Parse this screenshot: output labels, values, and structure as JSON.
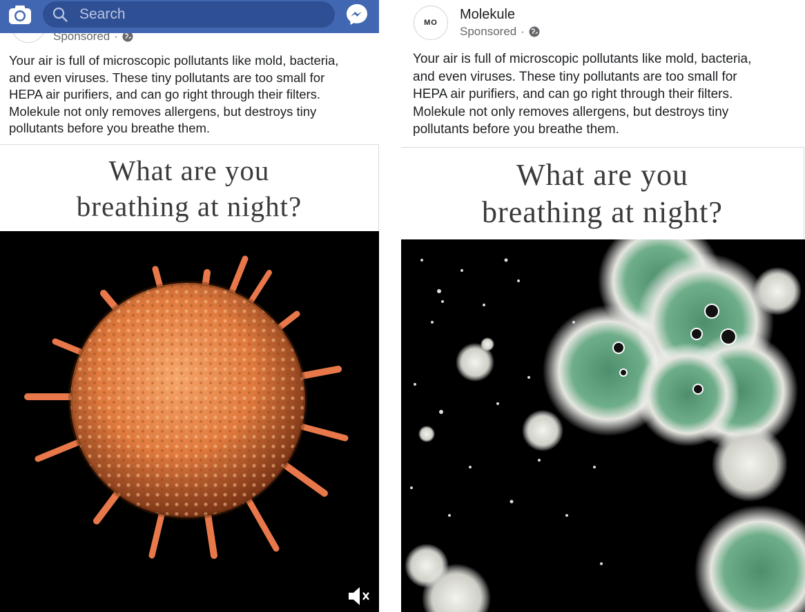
{
  "topbar": {
    "search_placeholder": "Search",
    "camera_icon": "camera-icon",
    "messenger_icon": "messenger-icon"
  },
  "left_post": {
    "sponsored": "Sponsored",
    "caption": "Your air is full of microscopic pollutants like mold, bacteria,\nand even viruses. These tiny pollutants are too small for\nHEPA air purifiers, and can go right through their filters.\nMolekule not only removes allergens, but destroys tiny\npollutants before you breathe them.",
    "headline": "What are you\nbreathing at night?",
    "mute_icon": "muted-speaker-icon"
  },
  "right_post": {
    "avatar_text": "MO",
    "page_name": "Molekule",
    "sponsored": "Sponsored",
    "caption": "Your air is full of microscopic pollutants like mold, bacteria,\nand even viruses. These tiny pollutants are too small for\nHEPA air purifiers, and can go right through their filters.\nMolekule not only removes allergens, but destroys tiny\npollutants before you breathe them.",
    "headline": "What are you\nbreathing at night?"
  },
  "colors": {
    "facebook_blue": "#4267b2",
    "search_bg": "#2f4f94"
  }
}
